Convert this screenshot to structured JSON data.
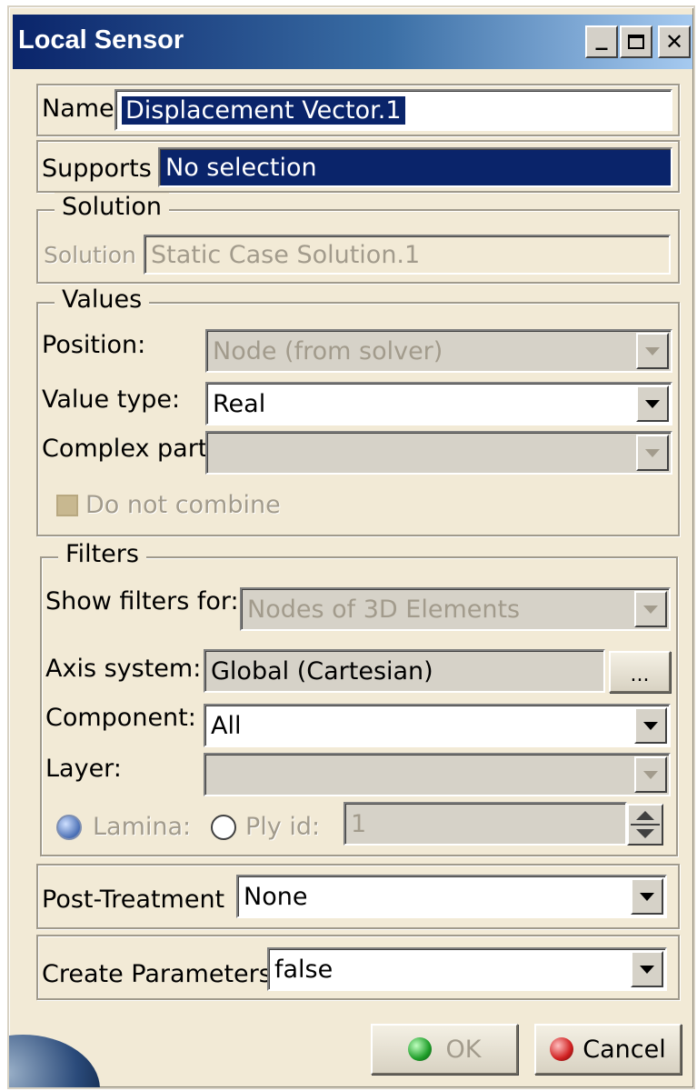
{
  "window": {
    "title": "Local Sensor",
    "minimize_glyph": "_",
    "maximize_glyph": "□",
    "close_glyph": "✕"
  },
  "name": {
    "label": "Name",
    "value": "Displacement Vector.1"
  },
  "supports": {
    "label": "Supports",
    "value": "No selection"
  },
  "solution": {
    "group_label": "Solution",
    "label": "Solution",
    "value": "Static Case Solution.1"
  },
  "values": {
    "group_label": "Values",
    "position_label": "Position:",
    "position_value": "Node (from solver)",
    "value_type_label": "Value type:",
    "value_type_value": "Real",
    "complex_part_label": "Complex part:",
    "complex_part_value": "",
    "do_not_combine_label": "Do not combine"
  },
  "filters": {
    "group_label": "Filters",
    "show_filters_label": "Show filters for:",
    "show_filters_value": "Nodes of 3D Elements",
    "axis_system_label": "Axis system:",
    "axis_system_value": "Global (Cartesian)",
    "browse_label": "...",
    "component_label": "Component:",
    "component_value": "All",
    "layer_label": "Layer:",
    "layer_value": "",
    "lamina_label": "Lamina:",
    "ply_id_label": "Ply id:",
    "ply_id_value": "1"
  },
  "post_treatment": {
    "label": "Post-Treatment",
    "value": "None"
  },
  "create_parameters": {
    "label": "Create Parameters",
    "value": "false"
  },
  "buttons": {
    "ok_label": "OK",
    "cancel_label": "Cancel"
  },
  "colors": {
    "dialog_bg": "#f2ead6",
    "title_gradient_start": "#0a246a",
    "selection_blue": "#0a246a",
    "disabled_text": "#a29b8c",
    "ok_icon": "#1f9e2a",
    "cancel_icon": "#d02020"
  }
}
